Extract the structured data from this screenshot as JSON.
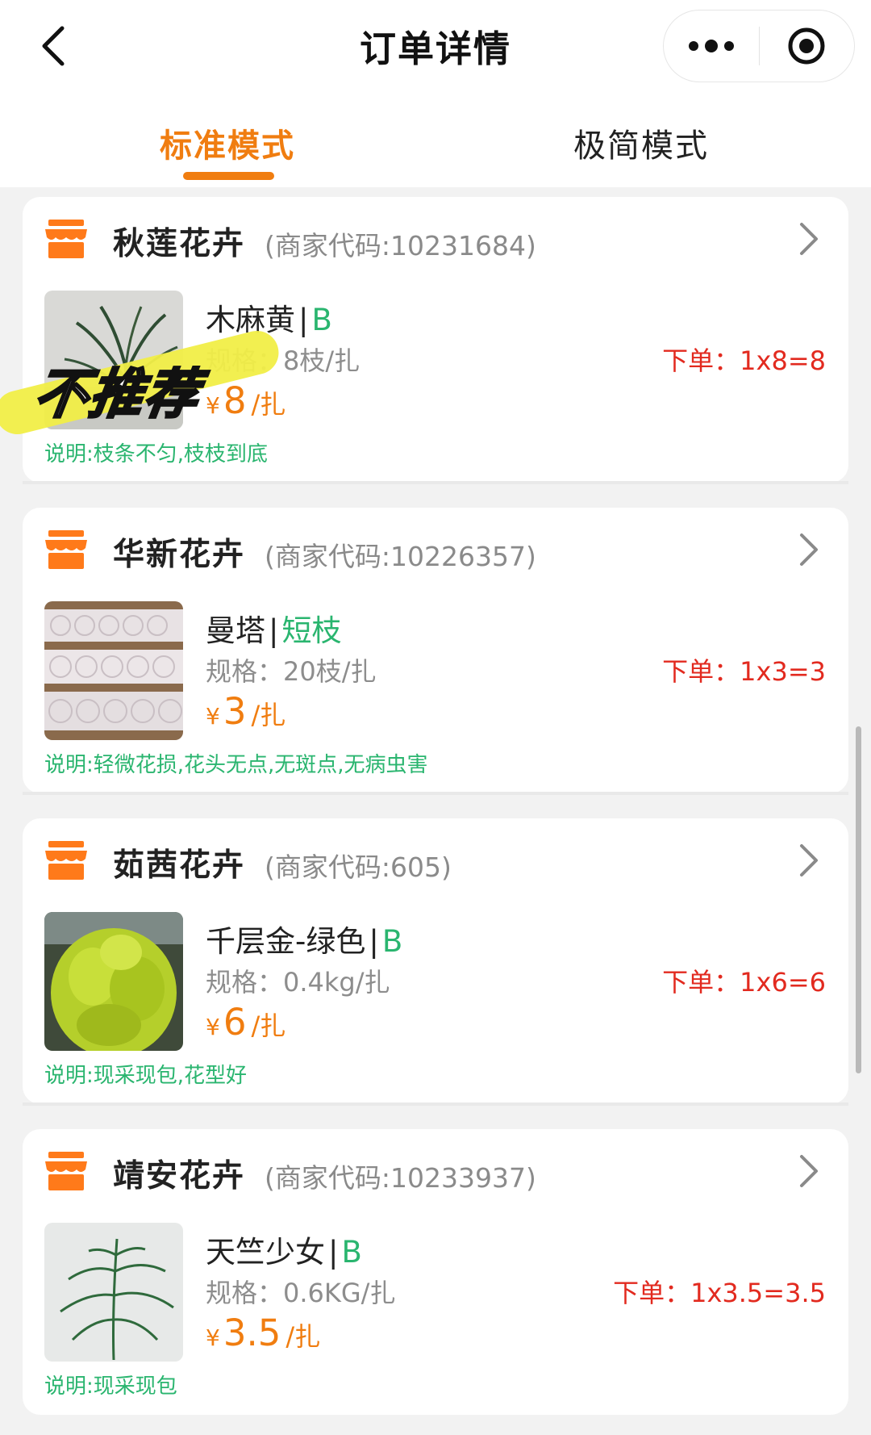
{
  "nav": {
    "title": "订单详情"
  },
  "tabs": [
    {
      "label": "标准模式",
      "active": true
    },
    {
      "label": "极简模式",
      "active": false
    }
  ],
  "colors": {
    "accent": "#f07d10",
    "grade_green": "#2ab56f",
    "order_red": "#e22a1f"
  },
  "watermark": "不推荐",
  "cards": [
    {
      "shop_name": "秋莲花卉",
      "merchant_code": "(商家代码:10231684)",
      "product": "木麻黄",
      "separator": "|",
      "grade": "B",
      "spec": "规格：8枝/扎",
      "currency": "¥",
      "price": "8",
      "unit": "/扎",
      "order": "下单：1x8=8",
      "note": "说明:枝条不匀,枝枝到底",
      "image": "casuarina-photo"
    },
    {
      "shop_name": "华新花卉",
      "merchant_code": "(商家代码:10226357)",
      "product": "曼塔",
      "separator": "|",
      "grade": "短枝",
      "spec": "规格：20枝/扎",
      "currency": "¥",
      "price": "3",
      "unit": "/扎",
      "order": "下单：1x3=3",
      "note": "说明:轻微花损,花头无点,无斑点,无病虫害",
      "image": "rose-box-photo"
    },
    {
      "shop_name": "茹茜花卉",
      "merchant_code": "(商家代码:605)",
      "product": "千层金-绿色",
      "separator": "|",
      "grade": "B",
      "spec": "规格：0.4kg/扎",
      "currency": "¥",
      "price": "6",
      "unit": "/扎",
      "order": "下单：1x6=6",
      "note": "说明:现采现包,花型好",
      "image": "melaleuca-photo"
    },
    {
      "shop_name": "靖安花卉",
      "merchant_code": "(商家代码:10233937)",
      "product": "天竺少女",
      "separator": "|",
      "grade": "B",
      "spec": "规格：0.6KG/扎",
      "currency": "¥",
      "price": "3.5",
      "unit": "/扎",
      "order": "下单：1x3.5=3.5",
      "note": "说明:现采现包",
      "image": "fern-photo"
    }
  ]
}
